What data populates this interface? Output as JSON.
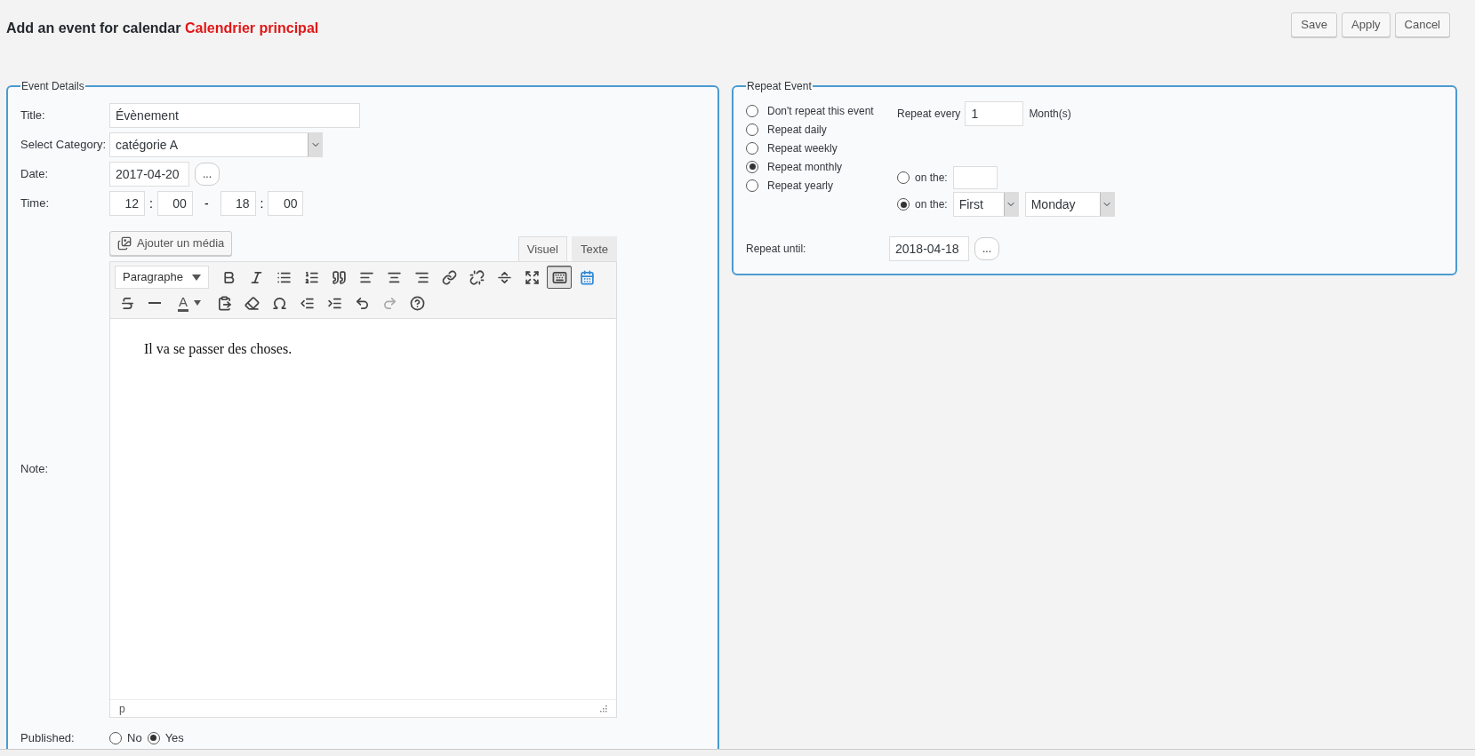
{
  "header": {
    "title": "Add an event for calendar",
    "calendar": "Calendrier principal"
  },
  "actions": [
    "Save",
    "Apply",
    "Cancel"
  ],
  "event_details": {
    "legend": "Event Details",
    "title": {
      "label": "Title:",
      "value": "Évènement"
    },
    "category": {
      "label": "Select Category:",
      "value": "catégorie A"
    },
    "date": {
      "label": "Date:",
      "value": "2017-04-20",
      "picker": "..."
    },
    "time": {
      "label": "Time:",
      "start_hour": "12",
      "start_minute": "00",
      "separator": "-",
      "end_hour": "18",
      "end_minute": "00",
      "colon": ":"
    },
    "note": {
      "label": "Note:",
      "media_button": "Ajouter un média",
      "tabs": [
        {
          "label": "Visuel",
          "selected": true
        },
        {
          "label": "Texte",
          "selected": false
        }
      ],
      "format": "Paragraphe",
      "toolbar": [
        [
          {
            "kind": "bold",
            "selected": false
          },
          {
            "kind": "italic",
            "selected": false
          },
          {
            "kind": "bullets",
            "selected": false
          },
          {
            "kind": "numbers",
            "selected": false
          },
          {
            "kind": "quote",
            "selected": false
          },
          {
            "kind": "align-left",
            "selected": false
          },
          {
            "kind": "align-center",
            "selected": false
          },
          {
            "kind": "align-right",
            "selected": false
          },
          {
            "kind": "link",
            "selected": false
          },
          {
            "kind": "unlink",
            "selected": false
          },
          {
            "kind": "more",
            "selected": false
          },
          {
            "kind": "fullscreen",
            "selected": false
          },
          {
            "kind": "toolbar-toggle",
            "selected": true
          },
          {
            "kind": "calendar",
            "selected": false
          }
        ],
        [
          {
            "kind": "strike",
            "selected": false
          },
          {
            "kind": "hr",
            "selected": false
          },
          {
            "kind": "text-color",
            "label": "A",
            "selected": false
          },
          {
            "kind": "paste",
            "selected": false
          },
          {
            "kind": "clear",
            "selected": false
          },
          {
            "kind": "omega",
            "selected": false
          },
          {
            "kind": "outdent",
            "selected": false
          },
          {
            "kind": "indent",
            "selected": false
          },
          {
            "kind": "undo",
            "selected": false
          },
          {
            "kind": "redo",
            "selected": false,
            "disabled": true
          },
          {
            "kind": "help",
            "selected": false
          }
        ]
      ],
      "content": "Il va se passer des choses.",
      "path": "p"
    },
    "published": {
      "label": "Published:",
      "options": [
        {
          "label": "No",
          "selected": false
        },
        {
          "label": "Yes",
          "selected": true
        }
      ]
    }
  },
  "repeat_event": {
    "legend": "Repeat Event",
    "modes": [
      {
        "label": "Don't repeat this event",
        "selected": false
      },
      {
        "label": "Repeat daily",
        "selected": false
      },
      {
        "label": "Repeat weekly",
        "selected": false
      },
      {
        "label": "Repeat monthly",
        "selected": true
      },
      {
        "label": "Repeat yearly",
        "selected": false
      }
    ],
    "every": {
      "label": "Repeat every",
      "value": "1",
      "unit": "Month(s)"
    },
    "on_the": [
      {
        "label": "on the:",
        "kind": "day",
        "selected": false
      },
      {
        "label": "on the:",
        "kind": "weekday",
        "selected": true,
        "week": "First",
        "weekday": "Monday"
      }
    ],
    "until": {
      "label": "Repeat until:",
      "value": "2018-04-18",
      "picker": "..."
    }
  }
}
